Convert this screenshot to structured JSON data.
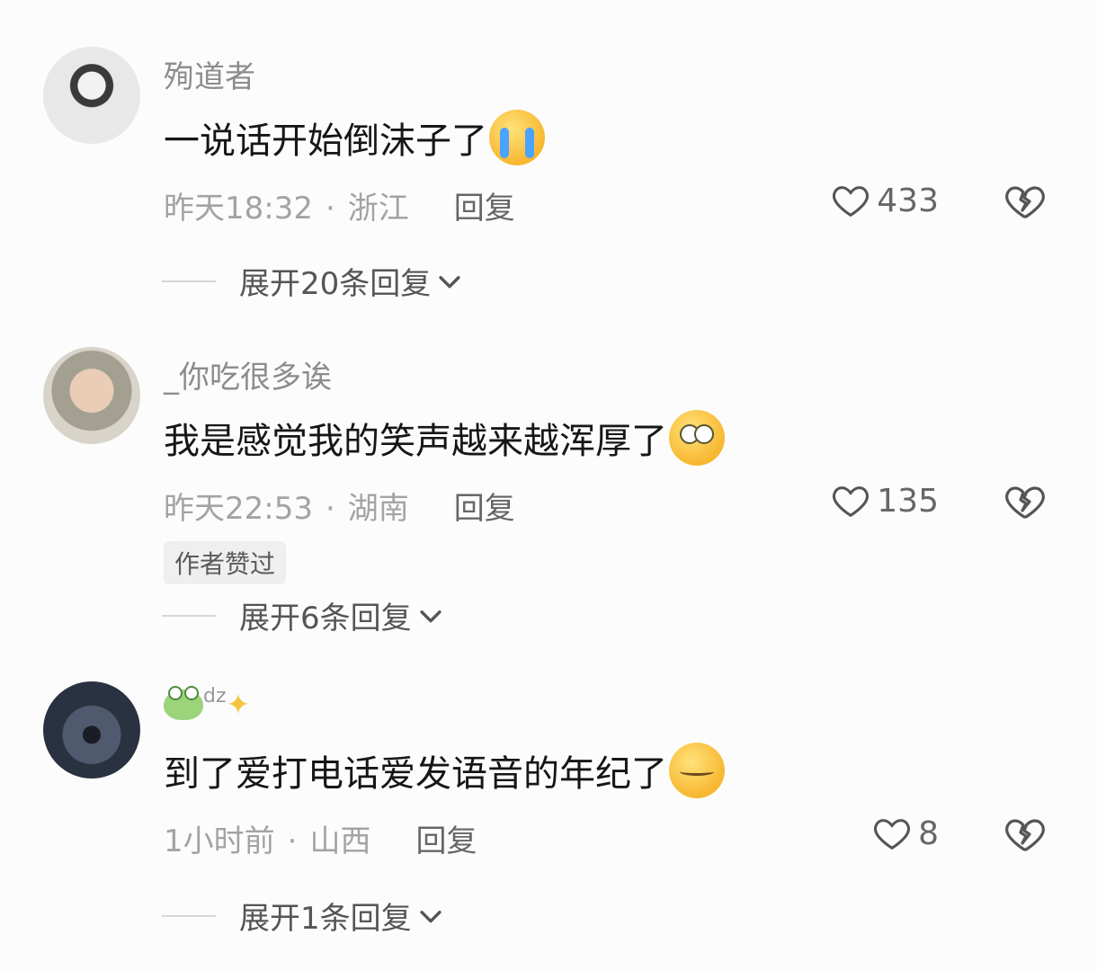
{
  "comments": [
    {
      "username": "殉道者",
      "text": "一说话开始倒沫子了",
      "emoji": "loudly-crying-face-icon",
      "time": "昨天18:32",
      "location": "浙江",
      "reply_label": "回复",
      "likes": "433",
      "badge": "",
      "expand_label": "展开20条回复"
    },
    {
      "username": "_你吃很多诶",
      "text": "我是感觉我的笑声越来越浑厚了",
      "emoji": "flushed-face-icon",
      "time": "昨天22:53",
      "location": "湖南",
      "reply_label": "回复",
      "likes": "135",
      "badge": "作者赞过",
      "expand_label": "展开6条回复"
    },
    {
      "username_suffix": "dz",
      "text": "到了爱打电话爱发语音的年纪了",
      "emoji": "smirk-face-icon",
      "time": "1小时前",
      "location": "山西",
      "reply_label": "回复",
      "likes": "8",
      "badge": "",
      "expand_label": "展开1条回复"
    }
  ],
  "separator": "·",
  "colors": {
    "background": "#fcfcfc",
    "text_primary": "#161616",
    "text_secondary": "#a3a3a3",
    "username": "#8c8c8c"
  }
}
